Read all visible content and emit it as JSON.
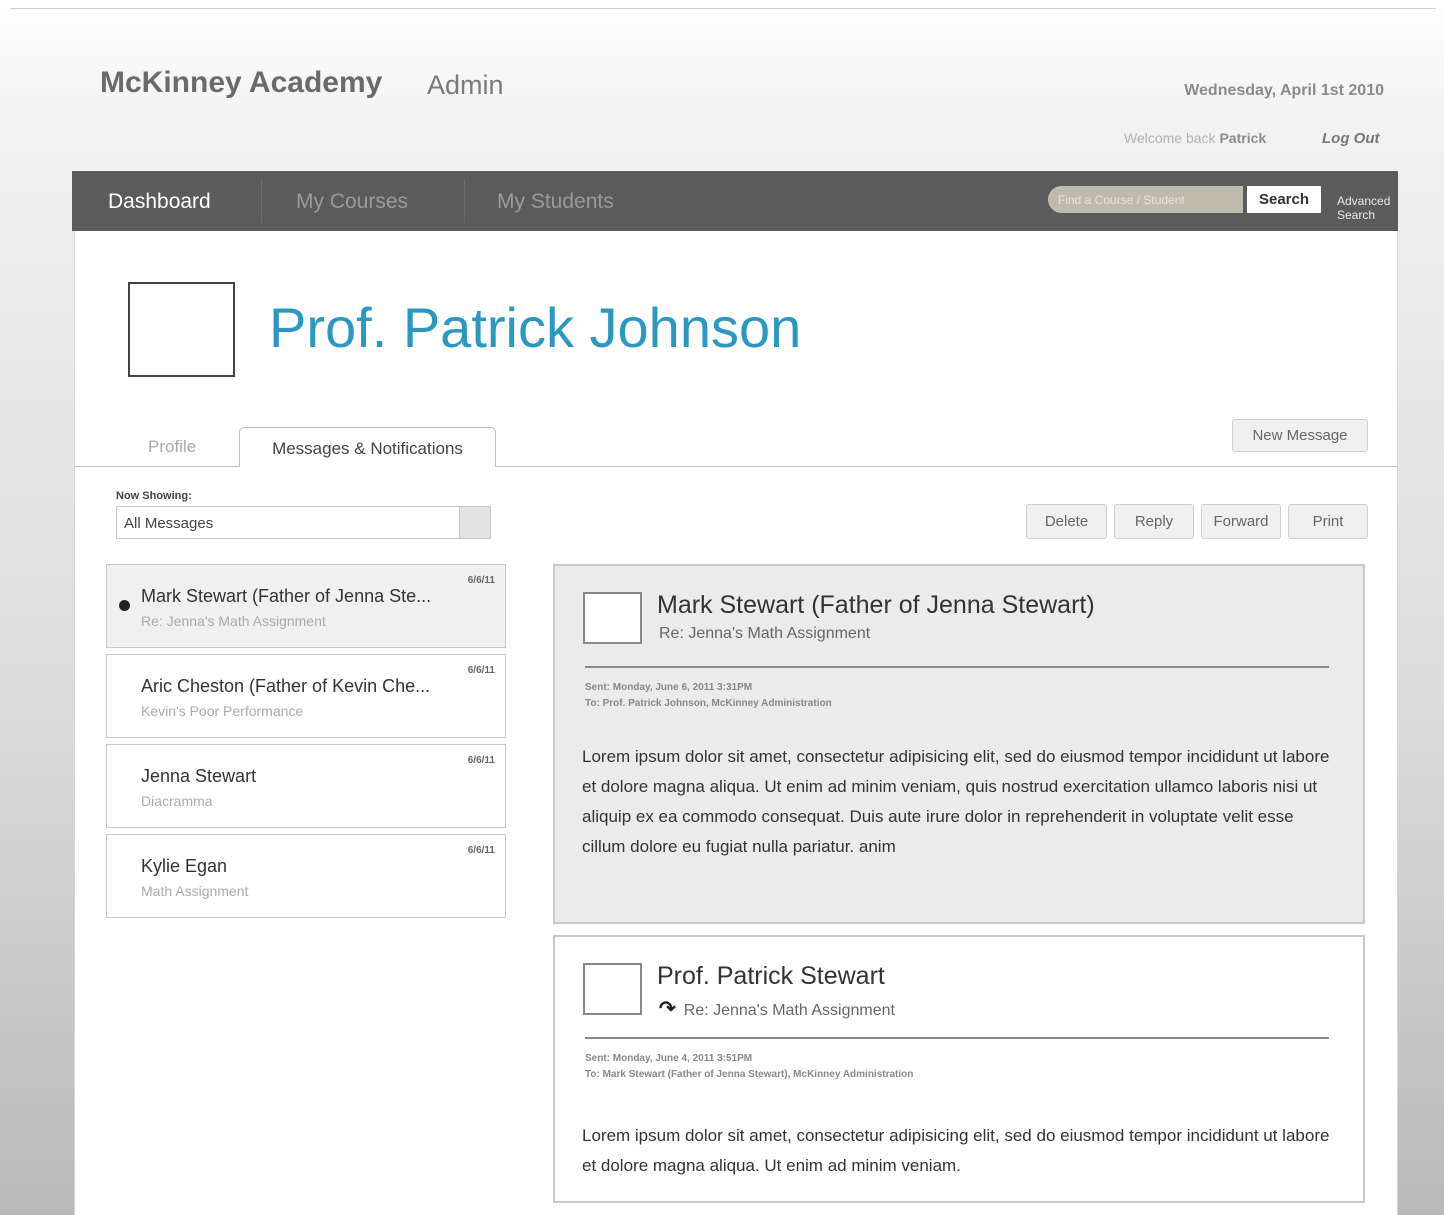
{
  "header": {
    "brand": "McKinney Academy",
    "brand_sub": "Admin",
    "date": "Wednesday, April 1st 2010",
    "welcome_prefix": "Welcome back",
    "user_name": "Patrick",
    "logout_label": "Log Out"
  },
  "nav": {
    "items": [
      {
        "label": "Dashboard"
      },
      {
        "label": "My Courses"
      },
      {
        "label": "My Students"
      }
    ],
    "search_placeholder": "Find a Course / Student",
    "search_button": "Search",
    "advanced_search": "Advanced Search"
  },
  "profile": {
    "name": "Prof. Patrick Johnson"
  },
  "tabs": [
    {
      "label": "Profile"
    },
    {
      "label": "Messages & Notifications"
    }
  ],
  "actions": {
    "new_message": "New Message",
    "delete": "Delete",
    "reply": "Reply",
    "forward": "Forward",
    "print": "Print"
  },
  "filter": {
    "label": "Now Showing:",
    "value": "All Messages"
  },
  "messages": [
    {
      "from": "Mark Stewart (Father of Jenna Ste...",
      "subject": "Re: Jenna's Math Assignment",
      "date": "6/6/11"
    },
    {
      "from": "Aric Cheston (Father of Kevin Che...",
      "subject": "Kevin's Poor Performance",
      "date": "6/6/11"
    },
    {
      "from": "Jenna Stewart",
      "subject": "Diacramma",
      "date": "6/6/11"
    },
    {
      "from": "Kylie Egan",
      "subject": "Math Assignment",
      "date": "6/6/11"
    }
  ],
  "thread": [
    {
      "from": "Mark Stewart (Father of Jenna Stewart)",
      "subject": "Re: Jenna's Math Assignment",
      "sent": "Sent: Monday, June 6, 2011 3:31PM",
      "to": "To: Prof. Patrick Johnson, McKinney Administration",
      "body": "Lorem ipsum dolor sit amet, consectetur adipisicing elit, sed do eiusmod tempor incididunt ut labore et dolore magna aliqua. Ut enim ad minim veniam, quis nostrud exercitation ullamco laboris nisi ut aliquip ex ea commodo consequat. Duis aute irure dolor in reprehenderit in voluptate velit esse cillum dolore eu fugiat nulla pariatur. anim"
    },
    {
      "from": "Prof. Patrick Stewart",
      "subject": "Re: Jenna's Math Assignment",
      "sent": "Sent: Monday, June 4, 2011 3:51PM",
      "to": "To: Mark Stewart (Father of Jenna Stewart), McKinney Administration",
      "body": "Lorem ipsum dolor sit amet, consectetur adipisicing elit, sed do eiusmod tempor incididunt ut labore et dolore magna aliqua. Ut enim ad minim veniam."
    }
  ],
  "icons": {
    "unread": "unread-dot-icon",
    "reply": "reply-arrow-icon",
    "dropdown": "chevron-down-icon"
  },
  "colors": {
    "accent": "#2a98c0",
    "navbar": "#5b5b5b"
  }
}
